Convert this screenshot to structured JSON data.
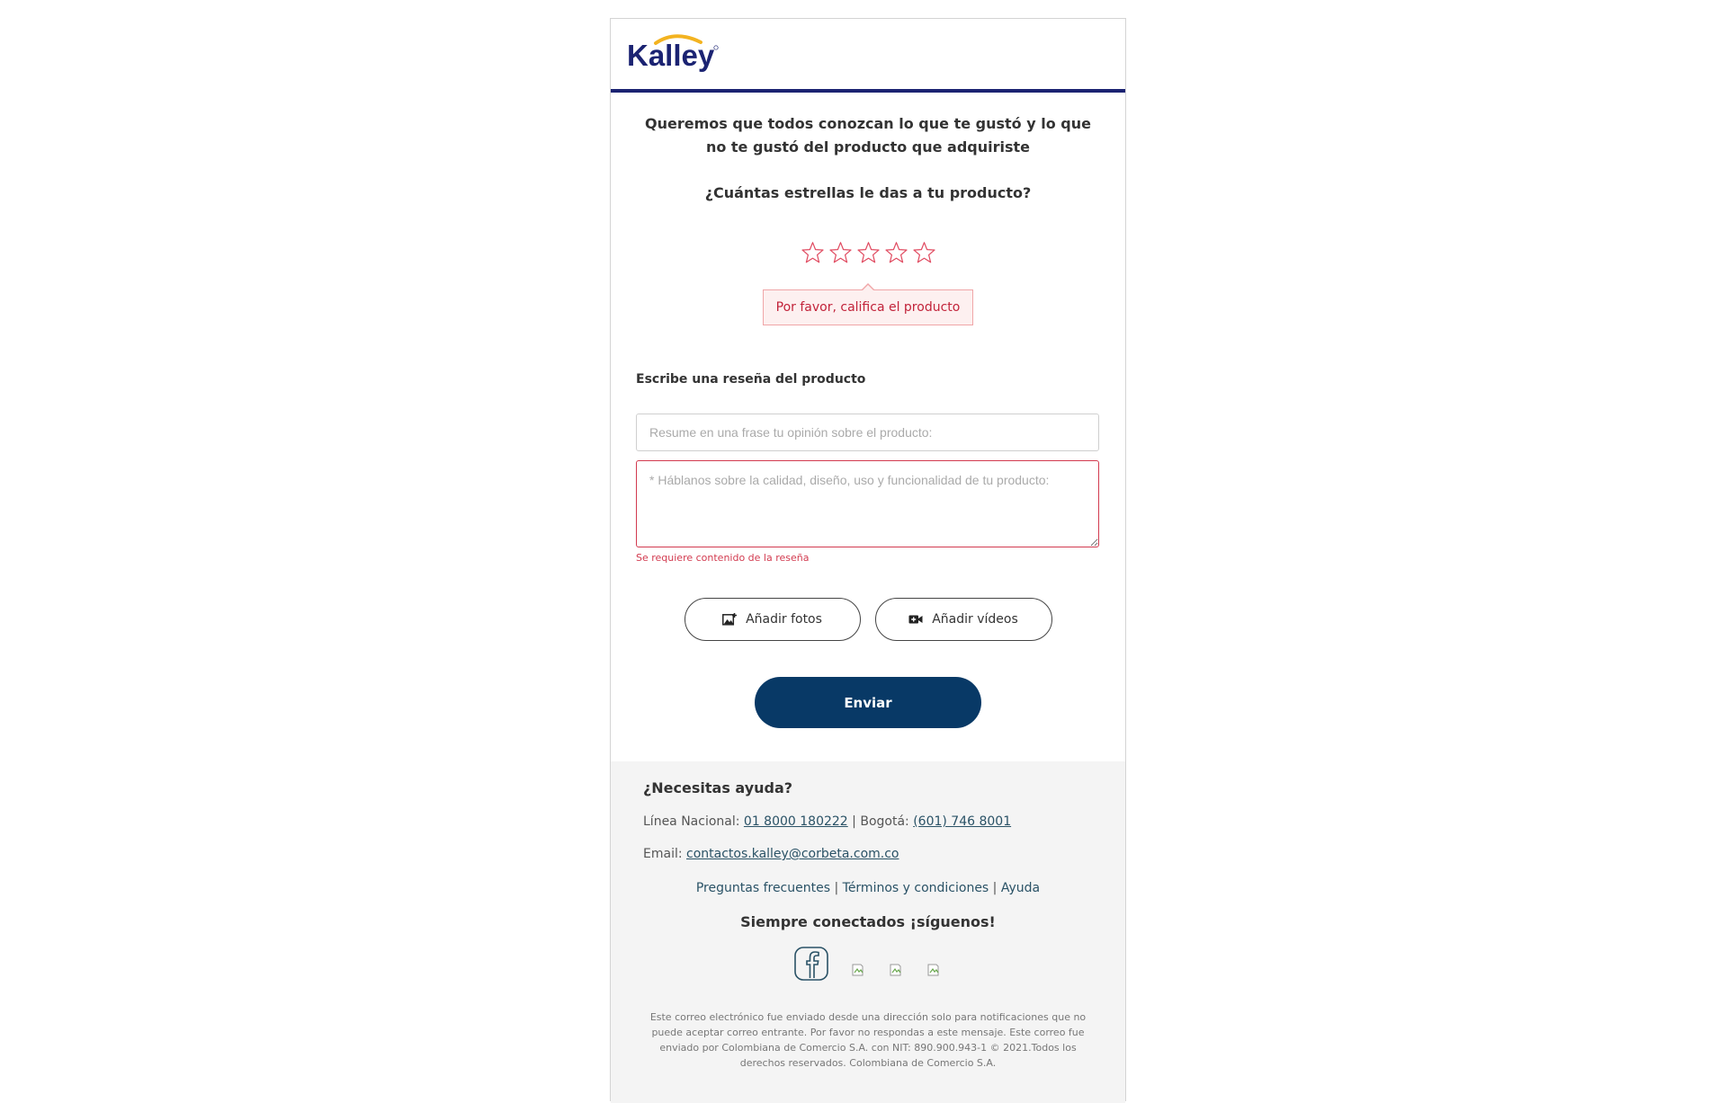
{
  "brand": {
    "logo_text": "Kalley",
    "accent_color": "#1b2372",
    "arc_color": "#f3b320"
  },
  "intro_text": "Queremos que todos conozcan lo que te gustó y lo que no te gustó del producto que adquiriste",
  "rating": {
    "question": "¿Cuántas estrellas le das a tu producto?",
    "max_stars": 5,
    "selected": 0,
    "error": "Por favor, califica el producto",
    "star_color": "#e0495f"
  },
  "review": {
    "label": "Escribe una reseña del producto",
    "summary_placeholder": "Resume en una frase tu opinión sobre el producto:",
    "body_placeholder": "* Háblanos sobre la calidad, diseño, uso y funcionalidad de tu producto:",
    "body_error": "Se requiere contenido de la reseña"
  },
  "media": {
    "photos_label": "Añadir fotos",
    "photos_icon": "add-photo-icon",
    "videos_label": "Añadir vídeos",
    "videos_icon": "video-camera-icon"
  },
  "submit_label": "Enviar",
  "submit_color": "#083966",
  "footer": {
    "help_title": "¿Necesitas ayuda?",
    "national_label": "Línea Nacional: ",
    "national_phone": "01 8000 180222",
    "separator": " | ",
    "bogota_label": "Bogotá: ",
    "bogota_phone": "(601) 746 8001",
    "email_label": "Email: ",
    "email": "contactos.kalley@corbeta.com.co",
    "links": [
      "Preguntas frecuentes",
      "Términos y condiciones",
      "Ayuda"
    ],
    "follow_text": "Siempre conectados ¡síguenos!",
    "social_icons": [
      "facebook-icon",
      "broken-image-icon",
      "broken-image-icon",
      "broken-image-icon"
    ],
    "disclaimer": "Este correo electrónico fue enviado desde una dirección solo para notificaciones que no puede aceptar correo entrante. Por favor no respondas a este mensaje. Este correo fue enviado por Colombiana de Comercio S.A. con NIT: 890.900.943-1 © 2021.Todos los derechos reservados. Colombiana de Comercio S.A."
  }
}
